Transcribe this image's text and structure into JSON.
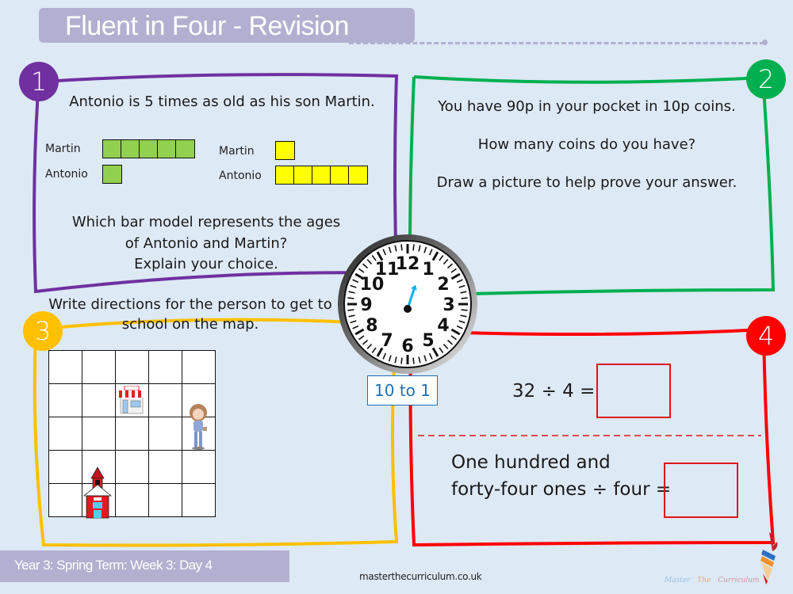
{
  "header": {
    "title": "Fluent in Four - Revision"
  },
  "colors": {
    "background": "#dde9f5",
    "title_bg": "#b3afd0",
    "q1": "#7030a0",
    "q2": "#00b050",
    "q3": "#ffc000",
    "q4": "#ff0000",
    "bar_green": "#92d050",
    "bar_yellow": "#ffff00",
    "clock_hand": "#00b0f0",
    "time_label": "#1f6fb5"
  },
  "questions": [
    {
      "number": "1",
      "statement": "Antonio is 5 times as old as his son Martin.",
      "bar_models": [
        {
          "color": "green",
          "rows": [
            {
              "label": "Martin",
              "units": 5
            },
            {
              "label": "Antonio",
              "units": 1
            }
          ]
        },
        {
          "color": "yellow",
          "rows": [
            {
              "label": "Martin",
              "units": 1
            },
            {
              "label": "Antonio",
              "units": 5
            }
          ]
        }
      ],
      "prompt_line1": "Which bar model represents the ages",
      "prompt_line2": "of Antonio and Martin?",
      "prompt_line3": "Explain your choice."
    },
    {
      "number": "2",
      "line1": "You have 90p in your pocket in 10p coins.",
      "line2": "How many coins do you have?",
      "line3": "Draw a picture to help prove your answer."
    },
    {
      "number": "3",
      "line1": "Write directions for the person to get to",
      "line2": "school on the map.",
      "map": {
        "rows": 5,
        "cols": 5,
        "items": [
          {
            "name": "shop",
            "label": "shop",
            "row": 2,
            "col": 3
          },
          {
            "name": "person",
            "row": 2.5,
            "col": 5
          },
          {
            "name": "school",
            "label": "school",
            "row": 4.5,
            "col": 2
          }
        ]
      }
    },
    {
      "number": "4",
      "eq1": "32 ÷ 4 =",
      "eq2_line1": "One hundred and",
      "eq2_line2": "forty-four ones ÷ four ="
    }
  ],
  "clock": {
    "numbers": [
      "12",
      "1",
      "2",
      "3",
      "4",
      "5",
      "6",
      "7",
      "8",
      "9",
      "10",
      "11"
    ],
    "hand_points_to_minute": 3,
    "time_label": "10 to 1"
  },
  "footer": {
    "lesson": "Year 3: Spring Term: Week 3: Day 4",
    "site": "masterthecurriculum.co.uk",
    "brand_words": [
      "Master",
      "The",
      "Curriculum"
    ]
  }
}
